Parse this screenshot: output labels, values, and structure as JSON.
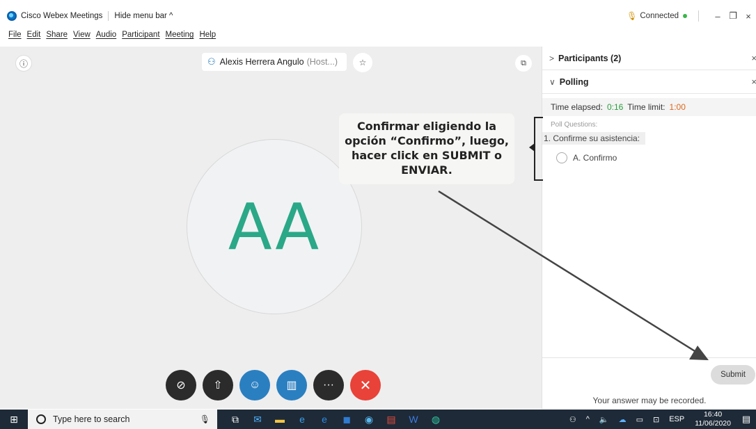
{
  "titlebar": {
    "app_title": "Cisco Webex Meetings",
    "hide_menu": "Hide menu bar ^",
    "status": "Connected",
    "minimize": "–",
    "restore": "❐",
    "close": "×"
  },
  "menu": [
    "File",
    "Edit",
    "Share",
    "View",
    "Audio",
    "Participant",
    "Meeting",
    "Help"
  ],
  "stage": {
    "host_name": "Alexis Herrera Angulo",
    "host_role": "(Host...)",
    "avatar_initials": "AA"
  },
  "callout": {
    "lines": [
      "Confirmar eligiendo la",
      "opción “Confirmo”, luego,",
      "hacer click en SUBMIT o",
      "ENVIAR."
    ]
  },
  "panel": {
    "participants_label": "Participants (2)",
    "polling_label": "Polling",
    "time_elapsed_label": "Time elapsed:",
    "time_elapsed_value": "0:16",
    "time_limit_label": "Time limit:",
    "time_limit_value": "1:00",
    "poll_questions_header": "Poll Questions:",
    "question": "1. Confirme su asistencia:",
    "option_a": "A. Confirmo",
    "submit_label": "Submit",
    "record_note": "Your answer may be recorded."
  },
  "taskbar": {
    "search_placeholder": "Type here to search",
    "language": "ESP",
    "time": "16:40",
    "date": "11/06/2020"
  },
  "icons": {
    "host": "presenter-icon",
    "mute": "mic-muted-icon",
    "share": "share-icon",
    "participants": "participants-icon",
    "polling": "polling-icon",
    "more": "more-icon",
    "end": "end-call-icon"
  },
  "colors": {
    "accent_blue": "#2a7fc1",
    "end_red": "#e94238",
    "avatar_green": "#2aa887",
    "elapsed_green": "#2a9d3d",
    "limit_orange": "#e0661a",
    "taskbar": "#1e2a38"
  }
}
